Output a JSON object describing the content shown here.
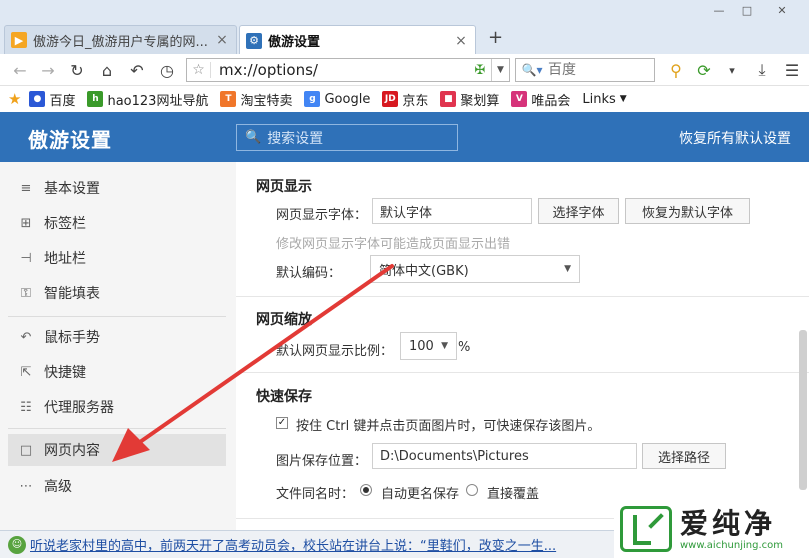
{
  "window": {
    "controls": [
      "—",
      "□",
      "✕"
    ]
  },
  "tabs": [
    {
      "title": "傲游今日_傲游用户专属的网...",
      "icon": "maxthon-home-icon",
      "active": false
    },
    {
      "title": "傲游设置",
      "icon": "gear-icon",
      "active": true
    }
  ],
  "toolbar": {
    "url": "mx://options/",
    "search_placeholder": "百度"
  },
  "bookmarks": [
    {
      "label": "百度",
      "icon": "baidu-icon",
      "color": "#2b58d6"
    },
    {
      "label": "hao123网址导航",
      "icon": "hao123-icon",
      "color": "#3a9a2a"
    },
    {
      "label": "淘宝特卖",
      "icon": "taobao-icon",
      "color": "#f0762a"
    },
    {
      "label": "Google",
      "icon": "google-icon",
      "color": "#4285f4"
    },
    {
      "label": "京东",
      "icon": "jd-icon",
      "color": "#d71920"
    },
    {
      "label": "聚划算",
      "icon": "juhuasuan-icon",
      "color": "#e0344f"
    },
    {
      "label": "唯品会",
      "icon": "vip-icon",
      "color": "#d6337a"
    },
    {
      "label": "Links",
      "icon": "",
      "color": ""
    }
  ],
  "settings": {
    "title": "傲游设置",
    "search_placeholder": "搜索设置",
    "restore_defaults": "恢复所有默认设置"
  },
  "sidebar": {
    "items": [
      {
        "label": "基本设置",
        "icon": "sliders-icon",
        "glyph": "≡"
      },
      {
        "label": "标签栏",
        "icon": "tabs-icon",
        "glyph": "⊞"
      },
      {
        "label": "地址栏",
        "icon": "address-bar-icon",
        "glyph": "⊣"
      },
      {
        "label": "智能填表",
        "icon": "key-icon",
        "glyph": "⚿"
      },
      {
        "label": "鼠标手势",
        "icon": "mouse-gesture-icon",
        "glyph": "↶"
      },
      {
        "label": "快捷键",
        "icon": "shortcut-icon",
        "glyph": "⇱"
      },
      {
        "label": "代理服务器",
        "icon": "proxy-icon",
        "glyph": "☷"
      },
      {
        "label": "网页内容",
        "icon": "page-content-icon",
        "glyph": "□"
      },
      {
        "label": "高级",
        "icon": "more-icon",
        "glyph": "…"
      }
    ],
    "selected_index": 7
  },
  "content": {
    "display": {
      "title": "网页显示",
      "font_label": "网页显示字体：",
      "font_value": "默认字体",
      "choose_font": "选择字体",
      "restore_font": "恢复为默认字体",
      "hint": "修改网页显示字体可能造成页面显示出错",
      "encoding_label": "默认编码：",
      "encoding_value": "简体中文(GBK)"
    },
    "zoom": {
      "title": "网页缩放",
      "label": "默认网页显示比例：",
      "value": "100",
      "unit": "%"
    },
    "quicksave": {
      "title": "快速保存",
      "checkbox_label": "按住 Ctrl 键并点击页面图片时，可快速保存该图片。",
      "checked": true,
      "path_label": "图片保存位置：",
      "path_value": "D:\\Documents\\Pictures",
      "choose_path": "选择路径",
      "same_name_label": "文件同名时：",
      "option_rename": "自动更名保存",
      "option_overwrite": "直接覆盖",
      "selected_option": "rename"
    }
  },
  "statusbar": {
    "news": "听说老家村里的高中，前两天开了高考动员会，校长站在讲台上说：“里鞋们，改变之一生..."
  },
  "watermark": {
    "text": "爱纯净",
    "url": "www.aichunjing.com"
  },
  "colors": {
    "header_blue": "#2f71b8",
    "annotation_red": "#e23a36"
  }
}
